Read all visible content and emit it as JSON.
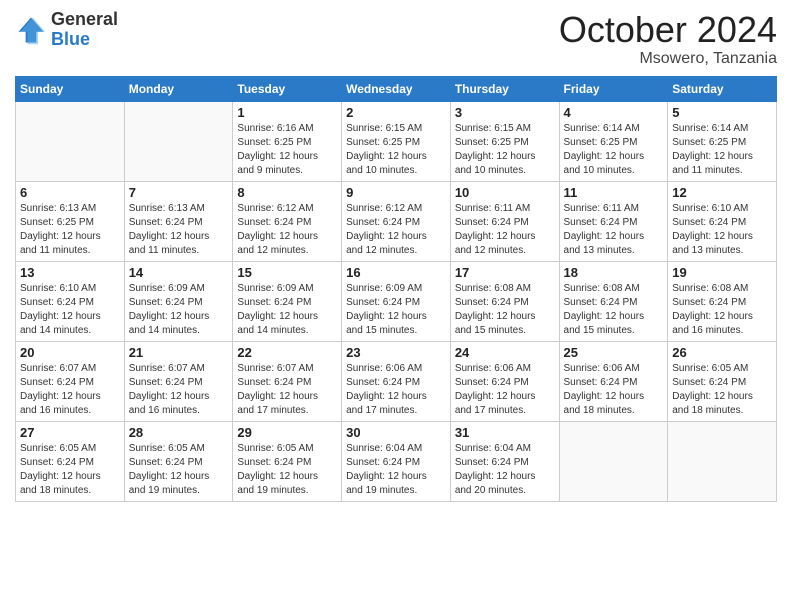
{
  "header": {
    "logo_general": "General",
    "logo_blue": "Blue",
    "title": "October 2024",
    "location": "Msowero, Tanzania"
  },
  "weekdays": [
    "Sunday",
    "Monday",
    "Tuesday",
    "Wednesday",
    "Thursday",
    "Friday",
    "Saturday"
  ],
  "weeks": [
    [
      {
        "day": "",
        "empty": true
      },
      {
        "day": "",
        "empty": true
      },
      {
        "day": "1",
        "sunrise": "Sunrise: 6:16 AM",
        "sunset": "Sunset: 6:25 PM",
        "daylight": "Daylight: 12 hours and 9 minutes."
      },
      {
        "day": "2",
        "sunrise": "Sunrise: 6:15 AM",
        "sunset": "Sunset: 6:25 PM",
        "daylight": "Daylight: 12 hours and 10 minutes."
      },
      {
        "day": "3",
        "sunrise": "Sunrise: 6:15 AM",
        "sunset": "Sunset: 6:25 PM",
        "daylight": "Daylight: 12 hours and 10 minutes."
      },
      {
        "day": "4",
        "sunrise": "Sunrise: 6:14 AM",
        "sunset": "Sunset: 6:25 PM",
        "daylight": "Daylight: 12 hours and 10 minutes."
      },
      {
        "day": "5",
        "sunrise": "Sunrise: 6:14 AM",
        "sunset": "Sunset: 6:25 PM",
        "daylight": "Daylight: 12 hours and 11 minutes."
      }
    ],
    [
      {
        "day": "6",
        "sunrise": "Sunrise: 6:13 AM",
        "sunset": "Sunset: 6:25 PM",
        "daylight": "Daylight: 12 hours and 11 minutes."
      },
      {
        "day": "7",
        "sunrise": "Sunrise: 6:13 AM",
        "sunset": "Sunset: 6:24 PM",
        "daylight": "Daylight: 12 hours and 11 minutes."
      },
      {
        "day": "8",
        "sunrise": "Sunrise: 6:12 AM",
        "sunset": "Sunset: 6:24 PM",
        "daylight": "Daylight: 12 hours and 12 minutes."
      },
      {
        "day": "9",
        "sunrise": "Sunrise: 6:12 AM",
        "sunset": "Sunset: 6:24 PM",
        "daylight": "Daylight: 12 hours and 12 minutes."
      },
      {
        "day": "10",
        "sunrise": "Sunrise: 6:11 AM",
        "sunset": "Sunset: 6:24 PM",
        "daylight": "Daylight: 12 hours and 12 minutes."
      },
      {
        "day": "11",
        "sunrise": "Sunrise: 6:11 AM",
        "sunset": "Sunset: 6:24 PM",
        "daylight": "Daylight: 12 hours and 13 minutes."
      },
      {
        "day": "12",
        "sunrise": "Sunrise: 6:10 AM",
        "sunset": "Sunset: 6:24 PM",
        "daylight": "Daylight: 12 hours and 13 minutes."
      }
    ],
    [
      {
        "day": "13",
        "sunrise": "Sunrise: 6:10 AM",
        "sunset": "Sunset: 6:24 PM",
        "daylight": "Daylight: 12 hours and 14 minutes."
      },
      {
        "day": "14",
        "sunrise": "Sunrise: 6:09 AM",
        "sunset": "Sunset: 6:24 PM",
        "daylight": "Daylight: 12 hours and 14 minutes."
      },
      {
        "day": "15",
        "sunrise": "Sunrise: 6:09 AM",
        "sunset": "Sunset: 6:24 PM",
        "daylight": "Daylight: 12 hours and 14 minutes."
      },
      {
        "day": "16",
        "sunrise": "Sunrise: 6:09 AM",
        "sunset": "Sunset: 6:24 PM",
        "daylight": "Daylight: 12 hours and 15 minutes."
      },
      {
        "day": "17",
        "sunrise": "Sunrise: 6:08 AM",
        "sunset": "Sunset: 6:24 PM",
        "daylight": "Daylight: 12 hours and 15 minutes."
      },
      {
        "day": "18",
        "sunrise": "Sunrise: 6:08 AM",
        "sunset": "Sunset: 6:24 PM",
        "daylight": "Daylight: 12 hours and 15 minutes."
      },
      {
        "day": "19",
        "sunrise": "Sunrise: 6:08 AM",
        "sunset": "Sunset: 6:24 PM",
        "daylight": "Daylight: 12 hours and 16 minutes."
      }
    ],
    [
      {
        "day": "20",
        "sunrise": "Sunrise: 6:07 AM",
        "sunset": "Sunset: 6:24 PM",
        "daylight": "Daylight: 12 hours and 16 minutes."
      },
      {
        "day": "21",
        "sunrise": "Sunrise: 6:07 AM",
        "sunset": "Sunset: 6:24 PM",
        "daylight": "Daylight: 12 hours and 16 minutes."
      },
      {
        "day": "22",
        "sunrise": "Sunrise: 6:07 AM",
        "sunset": "Sunset: 6:24 PM",
        "daylight": "Daylight: 12 hours and 17 minutes."
      },
      {
        "day": "23",
        "sunrise": "Sunrise: 6:06 AM",
        "sunset": "Sunset: 6:24 PM",
        "daylight": "Daylight: 12 hours and 17 minutes."
      },
      {
        "day": "24",
        "sunrise": "Sunrise: 6:06 AM",
        "sunset": "Sunset: 6:24 PM",
        "daylight": "Daylight: 12 hours and 17 minutes."
      },
      {
        "day": "25",
        "sunrise": "Sunrise: 6:06 AM",
        "sunset": "Sunset: 6:24 PM",
        "daylight": "Daylight: 12 hours and 18 minutes."
      },
      {
        "day": "26",
        "sunrise": "Sunrise: 6:05 AM",
        "sunset": "Sunset: 6:24 PM",
        "daylight": "Daylight: 12 hours and 18 minutes."
      }
    ],
    [
      {
        "day": "27",
        "sunrise": "Sunrise: 6:05 AM",
        "sunset": "Sunset: 6:24 PM",
        "daylight": "Daylight: 12 hours and 18 minutes."
      },
      {
        "day": "28",
        "sunrise": "Sunrise: 6:05 AM",
        "sunset": "Sunset: 6:24 PM",
        "daylight": "Daylight: 12 hours and 19 minutes."
      },
      {
        "day": "29",
        "sunrise": "Sunrise: 6:05 AM",
        "sunset": "Sunset: 6:24 PM",
        "daylight": "Daylight: 12 hours and 19 minutes."
      },
      {
        "day": "30",
        "sunrise": "Sunrise: 6:04 AM",
        "sunset": "Sunset: 6:24 PM",
        "daylight": "Daylight: 12 hours and 19 minutes."
      },
      {
        "day": "31",
        "sunrise": "Sunrise: 6:04 AM",
        "sunset": "Sunset: 6:24 PM",
        "daylight": "Daylight: 12 hours and 20 minutes."
      },
      {
        "day": "",
        "empty": true
      },
      {
        "day": "",
        "empty": true
      }
    ]
  ]
}
